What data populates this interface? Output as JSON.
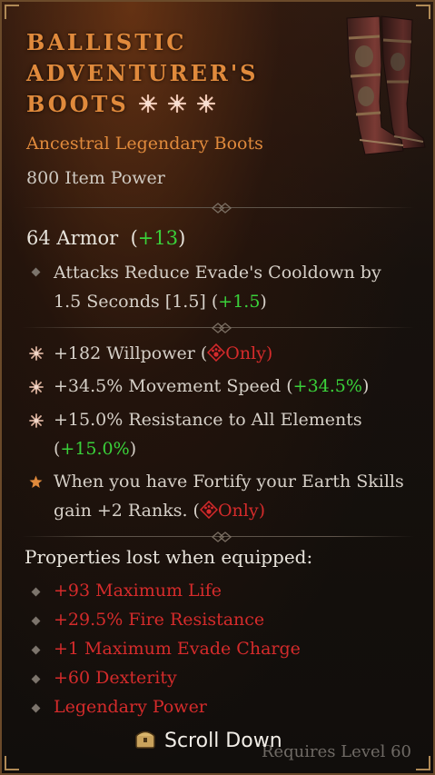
{
  "item": {
    "name_lines": [
      "BALLISTIC",
      "ADVENTURER'S",
      "BOOTS"
    ],
    "greater_affix_icon": "snowflake-star-icon",
    "type": "Ancestral Legendary Boots",
    "item_power": "800 Item Power",
    "image": "boots-icon"
  },
  "armor": {
    "value": "64 Armor",
    "diff_open": "(",
    "diff": "+13",
    "diff_close": ")"
  },
  "implicit": {
    "text": "Attacks Reduce Evade's Cooldown by 1.5 Seconds [1.5] (",
    "diff": "+1.5",
    "diff_close": ")"
  },
  "affixes": [
    {
      "text": "+182 Willpower (",
      "class_only": "Only)",
      "class_icon": "druid-claw-icon"
    },
    {
      "text": "+34.5% Movement Speed (",
      "diff": "+34.5%",
      "diff_close": ")"
    },
    {
      "text": "+15.0% Resistance to All Elements (",
      "diff": "+15.0%",
      "diff_close": ")"
    }
  ],
  "legendary": {
    "icon": "legendary-star-icon",
    "text": "When you have Fortify your Earth Skills gain +2 Ranks. (",
    "class_only": "Only)",
    "class_icon": "druid-claw-icon"
  },
  "lost": {
    "title": "Properties lost when equipped:",
    "items": [
      "+93 Maximum Life",
      "+29.5% Fire Resistance",
      "+1 Maximum Evade Charge",
      "+60 Dexterity",
      "Legendary Power"
    ]
  },
  "footer": {
    "scroll_label": "Scroll Down",
    "scroll_icon": "chest-icon",
    "requires": "Requires Level 60"
  },
  "colors": {
    "legendary_orange": "#e08a3c",
    "gain_green": "#3ad13a",
    "loss_red": "#d52b2b",
    "text_light": "#d6d0c8"
  }
}
